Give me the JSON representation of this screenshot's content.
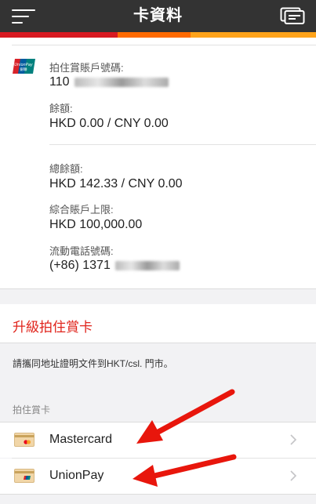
{
  "header": {
    "title": "卡資料",
    "stripe_colors": [
      "#d71921",
      "#d71921",
      "#ff6a00",
      "#ffa31a"
    ]
  },
  "account": {
    "card_number_label": "拍住賞賬戶號碼:",
    "card_number_visible": "110",
    "balance_label": "餘額:",
    "balance_value": "HKD 0.00 / CNY 0.00",
    "total_balance_label": "總餘額:",
    "total_balance_value": "HKD 142.33 / CNY 0.00",
    "limit_label": "綜合賬戶上限:",
    "limit_value": "HKD 100,000.00",
    "phone_label": "流動電話號碼:",
    "phone_value_visible": "(+86) 1371"
  },
  "upgrade": {
    "label": "升級拍住賞卡"
  },
  "note": {
    "text": "請攜同地址證明文件到HKT/csl. 門市。"
  },
  "cards_section": {
    "header": "拍住賞卡",
    "items": [
      {
        "label": "Mastercard",
        "icon": "mastercard-icon"
      },
      {
        "label": "UnionPay",
        "icon": "unionpay-icon"
      }
    ]
  },
  "colors": {
    "accent_red": "#e0241c",
    "arrow_red": "#e8160c",
    "header_bg": "#333333"
  }
}
